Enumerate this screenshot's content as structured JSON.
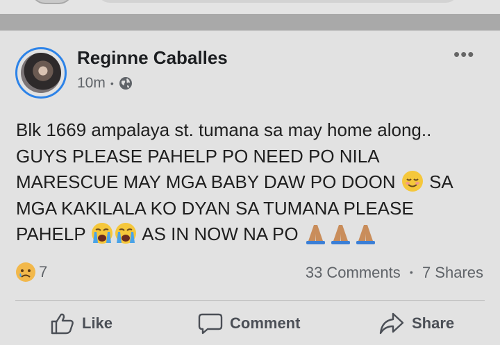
{
  "post": {
    "author": "Reginne Caballes",
    "timestamp": "10m",
    "meta_separator": "•",
    "more_label": "•••",
    "text_lines": [
      "Blk 1669 ampalaya st. tumana sa may home along..",
      "GUYS PLEASE PAHELP PO NEED PO NILA",
      "MARESCUE MAY MGA BABY DAW PO DOON",
      "SA",
      "MGA KAKILALA KO DYAN SA TUMANA PLEASE",
      "PAHELP",
      "AS IN NOW NA PO"
    ]
  },
  "reactions": {
    "icon": "sad-face-icon",
    "count": "7"
  },
  "stats": {
    "comments": "33 Comments",
    "separator": "•",
    "shares": "7 Shares"
  },
  "actions": {
    "like": "Like",
    "comment": "Comment",
    "share": "Share"
  },
  "colors": {
    "avatar_ring": "#2d83e8",
    "background": "#e2e2e2",
    "divider": "#a9a9a9",
    "text": "#1f1f1f",
    "muted": "#5f6368"
  }
}
